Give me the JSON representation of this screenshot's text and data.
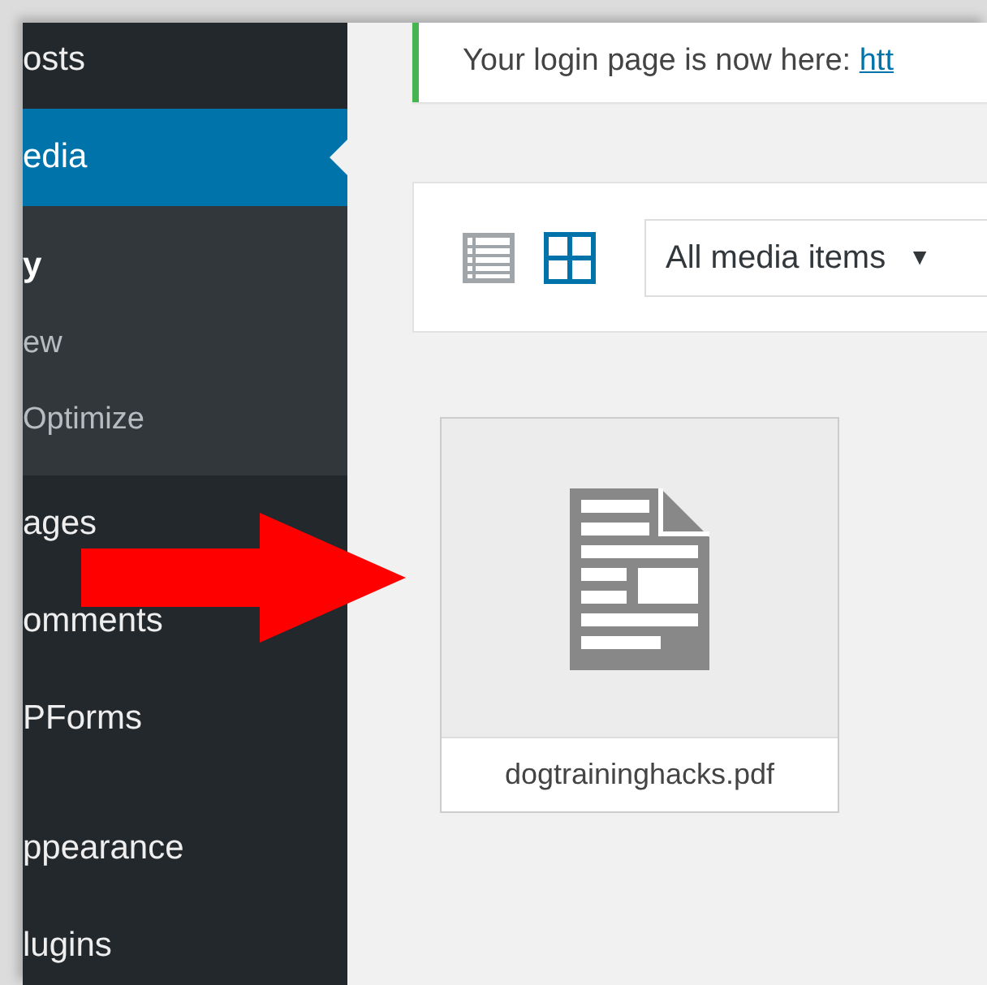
{
  "sidebar": {
    "items": [
      {
        "kind": "menu",
        "label": "osts",
        "selected": false
      },
      {
        "kind": "menu",
        "label": "edia",
        "selected": true
      },
      {
        "kind": "submenu",
        "label": "y",
        "selected": true
      },
      {
        "kind": "submenu",
        "label": "ew",
        "selected": false
      },
      {
        "kind": "submenu",
        "label": "Optimize",
        "selected": false
      },
      {
        "kind": "menu",
        "label": "ages",
        "selected": false
      },
      {
        "kind": "menu",
        "label": "omments",
        "selected": false
      },
      {
        "kind": "menu",
        "label": "PForms",
        "selected": false
      },
      {
        "kind": "separator"
      },
      {
        "kind": "menu",
        "label": "ppearance",
        "selected": false
      },
      {
        "kind": "menu",
        "label": "lugins",
        "selected": false
      }
    ]
  },
  "notice": {
    "text": "Your login page is now here: ",
    "link": "htt"
  },
  "toolbar": {
    "view_modes": [
      {
        "kind": "list",
        "selected": false
      },
      {
        "kind": "grid",
        "selected": true
      }
    ],
    "filter": "All media items",
    "dropdown_arrow": "▼"
  },
  "attachments": [
    {
      "kind": "document",
      "filename": "dogtraininghacks.pdf"
    }
  ]
}
